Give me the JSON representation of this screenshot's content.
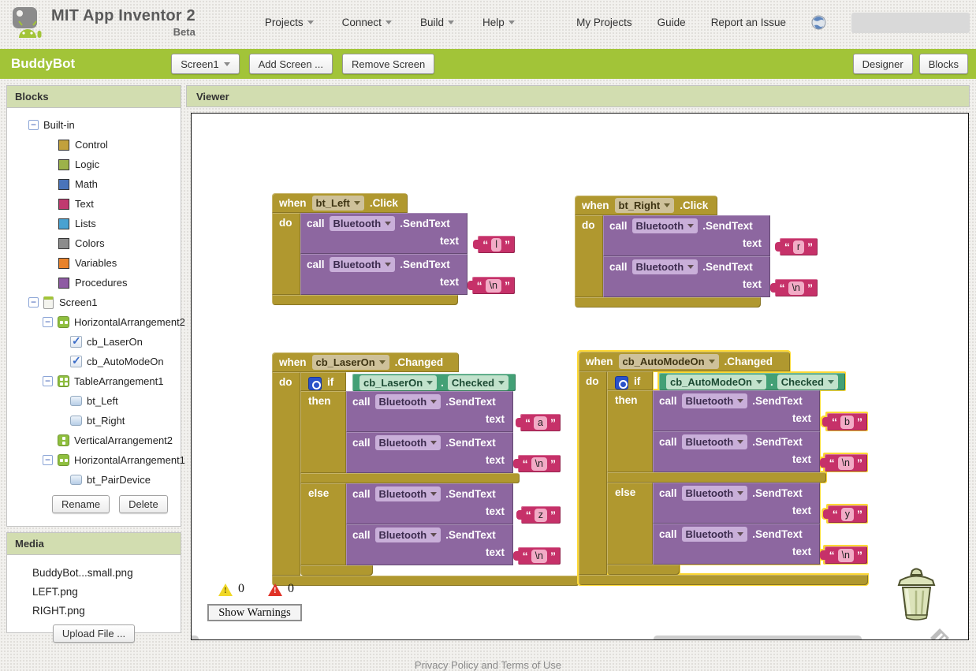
{
  "header": {
    "app_title": "MIT App Inventor 2",
    "app_subtitle": "Beta",
    "menus": [
      {
        "label": "Projects"
      },
      {
        "label": "Connect"
      },
      {
        "label": "Build"
      },
      {
        "label": "Help"
      }
    ],
    "nav_links": [
      {
        "label": "My Projects"
      },
      {
        "label": "Guide"
      },
      {
        "label": "Report an Issue"
      }
    ]
  },
  "toolbar": {
    "project_name": "BuddyBot",
    "screen_button": "Screen1",
    "add_screen_button": "Add Screen ...",
    "remove_screen_button": "Remove Screen",
    "designer_button": "Designer",
    "blocks_button": "Blocks"
  },
  "palette": {
    "title": "Blocks",
    "builtin_label": "Built-in",
    "builtin_items": [
      {
        "label": "Control",
        "color": "#c2a13c"
      },
      {
        "label": "Logic",
        "color": "#9cb24a"
      },
      {
        "label": "Math",
        "color": "#4a74ba"
      },
      {
        "label": "Text",
        "color": "#c03a6f"
      },
      {
        "label": "Lists",
        "color": "#49a2d1"
      },
      {
        "label": "Colors",
        "color": "#8c8c8c"
      },
      {
        "label": "Variables",
        "color": "#e8822b"
      },
      {
        "label": "Procedures",
        "color": "#8e5ba3"
      }
    ],
    "screen_label": "Screen1",
    "tree": [
      {
        "label": "HorizontalArrangement2"
      },
      {
        "label": "cb_LaserOn"
      },
      {
        "label": "cb_AutoModeOn"
      },
      {
        "label": "TableArrangement1"
      },
      {
        "label": "bt_Left"
      },
      {
        "label": "bt_Right"
      },
      {
        "label": "VerticalArrangement2"
      },
      {
        "label": "HorizontalArrangement1"
      },
      {
        "label": "bt_PairDevice"
      }
    ],
    "rename_button": "Rename",
    "delete_button": "Delete"
  },
  "media": {
    "title": "Media",
    "files": [
      {
        "name": "BuddyBot...small.png"
      },
      {
        "name": "LEFT.png"
      },
      {
        "name": "RIGHT.png"
      }
    ],
    "upload_button": "Upload File ..."
  },
  "viewer": {
    "title": "Viewer",
    "warning_count": "0",
    "error_count": "0",
    "show_warnings_button": "Show Warnings"
  },
  "footer": {
    "text": "Privacy Policy and Terms of Use"
  },
  "kw": {
    "when": "when",
    "do": "do",
    "call": "call",
    "if": "if",
    "then": "then",
    "else": "else",
    "text_param": "text",
    "dot": "."
  },
  "colors": {
    "green_bar": "#a2c438",
    "panel_header": "#d2ddb0",
    "event_block_gold": "#b0982f",
    "call_block_purple": "#8d67a0",
    "text_block_crimson": "#c63169",
    "getter_block_green": "#43a076",
    "selected_outline": "#fdd835"
  },
  "blocks_code": {
    "events": [
      {
        "component": "bt_Left",
        "event": ".Click",
        "calls": [
          {
            "component": "Bluetooth",
            "method": ".SendText",
            "value": "l"
          },
          {
            "component": "Bluetooth",
            "method": ".SendText",
            "value": "\\n"
          }
        ]
      },
      {
        "component": "bt_Right",
        "event": ".Click",
        "calls": [
          {
            "component": "Bluetooth",
            "method": ".SendText",
            "value": "r"
          },
          {
            "component": "Bluetooth",
            "method": ".SendText",
            "value": "\\n"
          }
        ]
      },
      {
        "component": "cb_LaserOn",
        "event": ".Changed",
        "condition": {
          "component": "cb_LaserOn",
          "property": "Checked"
        },
        "then_calls": [
          {
            "component": "Bluetooth",
            "method": ".SendText",
            "value": "a"
          },
          {
            "component": "Bluetooth",
            "method": ".SendText",
            "value": "\\n"
          }
        ],
        "else_calls": [
          {
            "component": "Bluetooth",
            "method": ".SendText",
            "value": "z"
          },
          {
            "component": "Bluetooth",
            "method": ".SendText",
            "value": "\\n"
          }
        ]
      },
      {
        "component": "cb_AutoModeOn",
        "event": ".Changed",
        "selected": true,
        "condition": {
          "component": "cb_AutoModeOn",
          "property": "Checked"
        },
        "then_calls": [
          {
            "component": "Bluetooth",
            "method": ".SendText",
            "value": "b"
          },
          {
            "component": "Bluetooth",
            "method": ".SendText",
            "value": "\\n"
          }
        ],
        "else_calls": [
          {
            "component": "Bluetooth",
            "method": ".SendText",
            "value": "y"
          },
          {
            "component": "Bluetooth",
            "method": ".SendText",
            "value": "\\n"
          }
        ]
      }
    ]
  }
}
